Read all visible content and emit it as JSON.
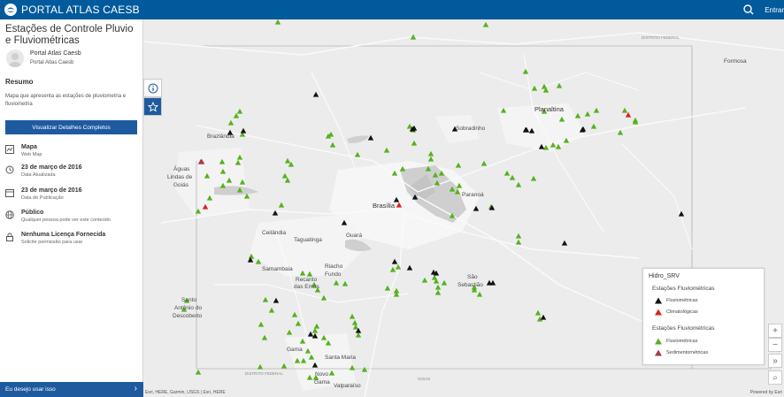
{
  "header": {
    "brand": "PORTAL ATLAS CAESB",
    "signin": "Entrar",
    "icons": [
      "caesb-logo-icon",
      "search-icon"
    ]
  },
  "item": {
    "title": "Estações de Controle Pluvio e Fluviométricas",
    "owner": "Portal Atlas Caesb",
    "owner_sub": "Portal Atlas Caesb",
    "summary_heading": "Resumo",
    "summary": "Mapa que apresenta as estações de pluviometria e fluviometria",
    "details_button": "Visualizar Detalhes Completos",
    "meta": [
      {
        "icon": "map-icon",
        "title": "Mapa",
        "sub": "Web Map"
      },
      {
        "icon": "history-icon",
        "title": "23 de março de 2016",
        "sub": "Data Atualizada"
      },
      {
        "icon": "calendar-icon",
        "title": "23 de março de 2016",
        "sub": "Data de Publicação"
      },
      {
        "icon": "globe-icon",
        "title": "Público",
        "sub": "Qualquer pessoa pode ver este conteúdo"
      },
      {
        "icon": "lock-icon",
        "title": "Nenhuma Licença Fornecida",
        "sub": "Solicite permissão para usar"
      }
    ],
    "use_this": "Eu desejo usar isso",
    "use_chevron": "›"
  },
  "map": {
    "places": {
      "formosa": "Formosa",
      "planaltina": "Planaltina",
      "sobradinho": "Sobradinho",
      "brazlandia": "Brazlândia",
      "aguas_lindas_1": "Águas",
      "aguas_lindas_2": "Lindas de",
      "aguas_lindas_3": "Goiás",
      "paranoa": "Paranoá",
      "brasilia": "Brasília",
      "ceilandia": "Ceilândia",
      "taguatinga": "Taguatinga",
      "guara": "Guará",
      "samambaia": "Samambaia",
      "riacho_1": "Riacho",
      "riacho_2": "Fundo",
      "recanto_1": "Recanto",
      "recanto_2": "das Emas",
      "sao_seb_1": "São",
      "sao_seb_2": "Sebastião",
      "santo_1": "Santo",
      "santo_2": "Antônio do",
      "santo_3": "Descoberto",
      "gama": "Gama",
      "santa_maria": "Santa Maria",
      "novo_gama_1": "Novo",
      "novo_gama_2": "Gama",
      "valparaiso": "Valparaíso",
      "df_label_top": "DISTRITO FEDERAL",
      "df_label_bottom": "DISTRITO FEDERAL",
      "goias_label": "GOIÁS"
    },
    "attribution": "Esri, HERE, Garmin, USGS | Esri, HERE",
    "powered": "Powered by Esri",
    "zoom_in": "+",
    "zoom_out": "−",
    "expand": "»",
    "search": "⌕"
  },
  "legend": {
    "layer": "Hidro_SRV",
    "groups": [
      {
        "title": "Estações Fluviométricas",
        "items": [
          {
            "label": "Fluviométricas",
            "color": "#111111"
          },
          {
            "label": "Climatológicas",
            "color": "#e02020"
          }
        ]
      },
      {
        "title": "Estações Fluviométricas",
        "items": [
          {
            "label": "Fluviométricas",
            "color": "#55b21d"
          },
          {
            "label": "Sedimentométricas",
            "color": "#a04040"
          }
        ]
      }
    ]
  },
  "colors": {
    "header": "#005a9c",
    "button": "#1e5aa0",
    "green": "#55b21d",
    "black": "#111111",
    "red": "#e02020",
    "brown": "#a04040"
  },
  "stations": {
    "green": [
      [
        152,
        3
      ],
      [
        305,
        20
      ],
      [
        387,
        6
      ],
      [
        432,
        59
      ],
      [
        442,
        78
      ],
      [
        453,
        76
      ],
      [
        470,
        75
      ],
      [
        455,
        80
      ],
      [
        407,
        103
      ],
      [
        453,
        104
      ],
      [
        544,
        103
      ],
      [
        556,
        116
      ],
      [
        473,
        113
      ],
      [
        539,
        128
      ],
      [
        509,
        121
      ],
      [
        478,
        137
      ],
      [
        469,
        144
      ],
      [
        455,
        145
      ],
      [
        463,
        142
      ],
      [
        556,
        114
      ],
      [
        512,
        103
      ],
      [
        502,
        107
      ],
      [
        491,
        109
      ],
      [
        105,
        109
      ],
      [
        109,
        104
      ],
      [
        99,
        117
      ],
      [
        112,
        130
      ],
      [
        89,
        161
      ],
      [
        109,
        156
      ],
      [
        90,
        188
      ],
      [
        112,
        184
      ],
      [
        72,
        177
      ],
      [
        90,
        172
      ],
      [
        97,
        182
      ],
      [
        75,
        202
      ],
      [
        62,
        217
      ],
      [
        117,
        200
      ],
      [
        109,
        193
      ],
      [
        107,
        162
      ],
      [
        167,
        164
      ],
      [
        163,
        160
      ],
      [
        209,
        132
      ],
      [
        214,
        142
      ],
      [
        306,
        140
      ],
      [
        275,
        148
      ],
      [
        325,
        152
      ],
      [
        325,
        158
      ],
      [
        322,
        169
      ],
      [
        330,
        176
      ],
      [
        332,
        185
      ],
      [
        337,
        174
      ],
      [
        284,
        174
      ],
      [
        293,
        169
      ],
      [
        356,
        165
      ],
      [
        385,
        163
      ],
      [
        357,
        188
      ],
      [
        355,
        195
      ],
      [
        349,
        192
      ],
      [
        411,
        174
      ],
      [
        417,
        179
      ],
      [
        441,
        180
      ],
      [
        424,
        187
      ],
      [
        349,
        222
      ],
      [
        393,
        212
      ],
      [
        305,
        125
      ],
      [
        301,
        121
      ],
      [
        242,
        153
      ],
      [
        212,
        130
      ],
      [
        163,
        182
      ],
      [
        160,
        177
      ],
      [
        156,
        210
      ],
      [
        122,
        268
      ],
      [
        130,
        274
      ],
      [
        180,
        287
      ],
      [
        188,
        288
      ],
      [
        193,
        300
      ],
      [
        197,
        306
      ],
      [
        204,
        315
      ],
      [
        218,
        298
      ],
      [
        228,
        299
      ],
      [
        282,
        283
      ],
      [
        288,
        280
      ],
      [
        276,
        304
      ],
      [
        286,
        307
      ],
      [
        286,
        311
      ],
      [
        318,
        295
      ],
      [
        329,
        292
      ],
      [
        331,
        296
      ],
      [
        333,
        303
      ],
      [
        333,
        309
      ],
      [
        340,
        298
      ],
      [
        374,
        306
      ],
      [
        380,
        311
      ],
      [
        374,
        303
      ],
      [
        446,
        332
      ],
      [
        448,
        339
      ],
      [
        424,
        252
      ],
      [
        424,
        245
      ],
      [
        46,
        328
      ],
      [
        49,
        318
      ],
      [
        236,
        336
      ],
      [
        239,
        343
      ],
      [
        186,
        375
      ],
      [
        196,
        347
      ],
      [
        190,
        382
      ],
      [
        209,
        366
      ],
      [
        188,
        405
      ],
      [
        194,
        352
      ],
      [
        180,
        364
      ],
      [
        62,
        399
      ],
      [
        132,
        393
      ],
      [
        159,
        392
      ],
      [
        213,
        400
      ],
      [
        236,
        394
      ],
      [
        165,
        354
      ],
      [
        145,
        329
      ],
      [
        138,
        317
      ],
      [
        240,
        348
      ],
      [
        243,
        357
      ],
      [
        171,
        334
      ],
      [
        175,
        344
      ],
      [
        250,
        396
      ],
      [
        204,
        360
      ],
      [
        137,
        360
      ],
      [
        174,
        386
      ],
      [
        133,
        345
      ],
      [
        181,
        386
      ],
      [
        195,
        405
      ]
    ],
    "black": [
      [
        98,
        128
      ],
      [
        113,
        126
      ],
      [
        257,
        134
      ],
      [
        195,
        85
      ],
      [
        304,
        124
      ],
      [
        306,
        123
      ],
      [
        352,
        124
      ],
      [
        432,
        125
      ],
      [
        439,
        126
      ],
      [
        497,
        124
      ],
      [
        433,
        125
      ],
      [
        149,
        219
      ],
      [
        227,
        230
      ],
      [
        286,
        204
      ],
      [
        307,
        201
      ],
      [
        376,
        214
      ],
      [
        394,
        213
      ],
      [
        476,
        253
      ],
      [
        121,
        272
      ],
      [
        284,
        274
      ],
      [
        328,
        286
      ],
      [
        331,
        287
      ],
      [
        395,
        298
      ],
      [
        150,
        318
      ],
      [
        189,
        356
      ],
      [
        194,
        358
      ],
      [
        243,
        352
      ],
      [
        194,
        391
      ],
      [
        452,
        337
      ],
      [
        608,
        220
      ],
      [
        450,
        144
      ],
      [
        496,
        125
      ],
      [
        301,
        281
      ],
      [
        391,
        298
      ]
    ],
    "red": [
      [
        66,
        161
      ],
      [
        70,
        212
      ],
      [
        289,
        210
      ],
      [
        548,
        108
      ]
    ],
    "brown": [
      [
        65,
        161
      ]
    ]
  }
}
